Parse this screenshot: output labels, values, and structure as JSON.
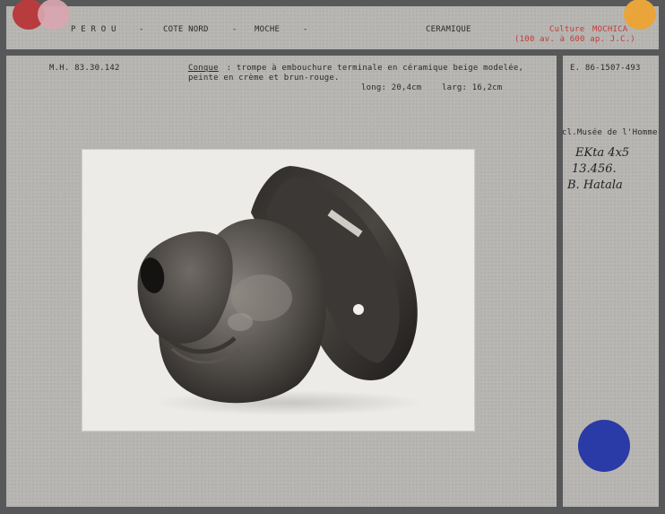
{
  "header": {
    "origin_parts": [
      "P E R O U",
      "-",
      "COTE NORD",
      "-",
      "MOCHE",
      "-"
    ],
    "category": "CERAMIQUE",
    "culture_prefix": "Culture",
    "culture_name": "MOCHICA",
    "dates": "(100 av. à 600 ap. J.C.)"
  },
  "record": {
    "inventory_number": "M.H. 83.30.142",
    "object_name": "Conque",
    "description_line1": " : trompe à embouchure terminale en céramique beige modelée,",
    "description_line2": "peinte en crème et brun-rouge.",
    "length": "long: 20,4cm",
    "width": "larg: 16,2cm"
  },
  "side": {
    "photo_number": "E. 86-1507-493",
    "credit": "cl.Musée de l'Homme",
    "handwritten_line1": "EKta 4x5",
    "handwritten_line2": "13.456.",
    "handwritten_line3": "B. Hatala"
  },
  "colors": {
    "background": "#57585a",
    "card": "#b8b6b2",
    "red_text": "#c13a3a",
    "dot_red": "#b83b3e",
    "dot_pink": "#d9a6b0",
    "dot_orange": "#e9a43a",
    "dot_blue": "#2a3aa6"
  }
}
